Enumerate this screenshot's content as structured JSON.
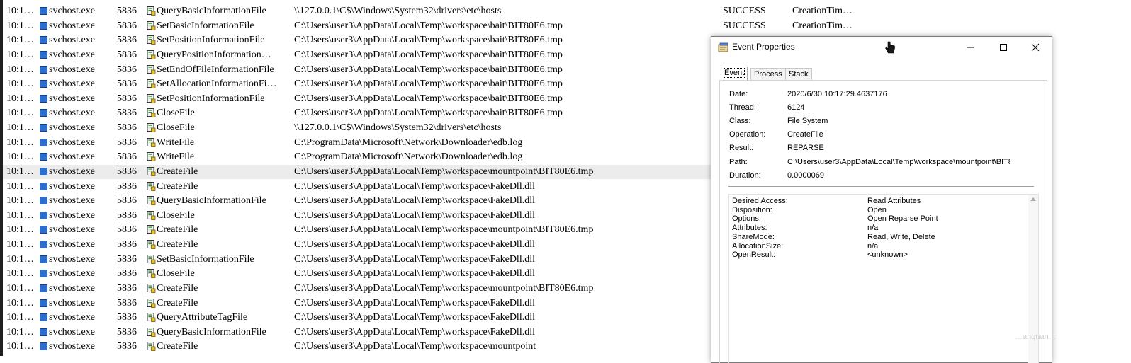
{
  "rows": [
    {
      "time": "10:1…",
      "process": "svchost.exe",
      "pid": "5836",
      "operation": "QueryBasicInformationFile",
      "path": "\\\\127.0.0.1\\C$\\Windows\\System32\\drivers\\etc\\hosts",
      "result": "SUCCESS",
      "detail": "CreationTim…"
    },
    {
      "time": "10:1…",
      "process": "svchost.exe",
      "pid": "5836",
      "operation": "SetBasicInformationFile",
      "path": "C:\\Users\\user3\\AppData\\Local\\Temp\\workspace\\bait\\BIT80E6.tmp",
      "result": "SUCCESS",
      "detail": "CreationTim…"
    },
    {
      "time": "10:1…",
      "process": "svchost.exe",
      "pid": "5836",
      "operation": "SetPositionInformationFile",
      "path": "C:\\Users\\user3\\AppData\\Local\\Temp\\workspace\\bait\\BIT80E6.tmp",
      "result": "",
      "detail": ""
    },
    {
      "time": "10:1…",
      "process": "svchost.exe",
      "pid": "5836",
      "operation": "QueryPositionInformation…",
      "path": "C:\\Users\\user3\\AppData\\Local\\Temp\\workspace\\bait\\BIT80E6.tmp",
      "result": "",
      "detail": ""
    },
    {
      "time": "10:1…",
      "process": "svchost.exe",
      "pid": "5836",
      "operation": "SetEndOfFileInformationFile",
      "path": "C:\\Users\\user3\\AppData\\Local\\Temp\\workspace\\bait\\BIT80E6.tmp",
      "result": "",
      "detail": ""
    },
    {
      "time": "10:1…",
      "process": "svchost.exe",
      "pid": "5836",
      "operation": "SetAllocationInformationFi…",
      "path": "C:\\Users\\user3\\AppData\\Local\\Temp\\workspace\\bait\\BIT80E6.tmp",
      "result": "",
      "detail": ""
    },
    {
      "time": "10:1…",
      "process": "svchost.exe",
      "pid": "5836",
      "operation": "SetPositionInformationFile",
      "path": "C:\\Users\\user3\\AppData\\Local\\Temp\\workspace\\bait\\BIT80E6.tmp",
      "result": "",
      "detail": ""
    },
    {
      "time": "10:1…",
      "process": "svchost.exe",
      "pid": "5836",
      "operation": "CloseFile",
      "path": "C:\\Users\\user3\\AppData\\Local\\Temp\\workspace\\bait\\BIT80E6.tmp",
      "result": "",
      "detail": ""
    },
    {
      "time": "10:1…",
      "process": "svchost.exe",
      "pid": "5836",
      "operation": "CloseFile",
      "path": "\\\\127.0.0.1\\C$\\Windows\\System32\\drivers\\etc\\hosts",
      "result": "",
      "detail": ""
    },
    {
      "time": "10:1…",
      "process": "svchost.exe",
      "pid": "5836",
      "operation": "WriteFile",
      "path": "C:\\ProgramData\\Microsoft\\Network\\Downloader\\edb.log",
      "result": "",
      "detail": ""
    },
    {
      "time": "10:1…",
      "process": "svchost.exe",
      "pid": "5836",
      "operation": "WriteFile",
      "path": "C:\\ProgramData\\Microsoft\\Network\\Downloader\\edb.log",
      "result": "",
      "detail": ""
    },
    {
      "time": "10:1…",
      "process": "svchost.exe",
      "pid": "5836",
      "operation": "CreateFile",
      "path": "C:\\Users\\user3\\AppData\\Local\\Temp\\workspace\\mountpoint\\BIT80E6.tmp",
      "result": "",
      "detail": "",
      "selected": true
    },
    {
      "time": "10:1…",
      "process": "svchost.exe",
      "pid": "5836",
      "operation": "CreateFile",
      "path": "C:\\Users\\user3\\AppData\\Local\\Temp\\workspace\\FakeDll.dll",
      "result": "",
      "detail": ""
    },
    {
      "time": "10:1…",
      "process": "svchost.exe",
      "pid": "5836",
      "operation": "QueryBasicInformationFile",
      "path": "C:\\Users\\user3\\AppData\\Local\\Temp\\workspace\\FakeDll.dll",
      "result": "",
      "detail": ""
    },
    {
      "time": "10:1…",
      "process": "svchost.exe",
      "pid": "5836",
      "operation": "CloseFile",
      "path": "C:\\Users\\user3\\AppData\\Local\\Temp\\workspace\\FakeDll.dll",
      "result": "",
      "detail": ""
    },
    {
      "time": "10:1…",
      "process": "svchost.exe",
      "pid": "5836",
      "operation": "CreateFile",
      "path": "C:\\Users\\user3\\AppData\\Local\\Temp\\workspace\\mountpoint\\BIT80E6.tmp",
      "result": "",
      "detail": ""
    },
    {
      "time": "10:1…",
      "process": "svchost.exe",
      "pid": "5836",
      "operation": "CreateFile",
      "path": "C:\\Users\\user3\\AppData\\Local\\Temp\\workspace\\FakeDll.dll",
      "result": "",
      "detail": ""
    },
    {
      "time": "10:1…",
      "process": "svchost.exe",
      "pid": "5836",
      "operation": "SetBasicInformationFile",
      "path": "C:\\Users\\user3\\AppData\\Local\\Temp\\workspace\\FakeDll.dll",
      "result": "",
      "detail": ""
    },
    {
      "time": "10:1…",
      "process": "svchost.exe",
      "pid": "5836",
      "operation": "CloseFile",
      "path": "C:\\Users\\user3\\AppData\\Local\\Temp\\workspace\\FakeDll.dll",
      "result": "",
      "detail": ""
    },
    {
      "time": "10:1…",
      "process": "svchost.exe",
      "pid": "5836",
      "operation": "CreateFile",
      "path": "C:\\Users\\user3\\AppData\\Local\\Temp\\workspace\\mountpoint\\BIT80E6.tmp",
      "result": "",
      "detail": ""
    },
    {
      "time": "10:1…",
      "process": "svchost.exe",
      "pid": "5836",
      "operation": "CreateFile",
      "path": "C:\\Users\\user3\\AppData\\Local\\Temp\\workspace\\FakeDll.dll",
      "result": "",
      "detail": ""
    },
    {
      "time": "10:1…",
      "process": "svchost.exe",
      "pid": "5836",
      "operation": "QueryAttributeTagFile",
      "path": "C:\\Users\\user3\\AppData\\Local\\Temp\\workspace\\FakeDll.dll",
      "result": "",
      "detail": ""
    },
    {
      "time": "10:1…",
      "process": "svchost.exe",
      "pid": "5836",
      "operation": "QueryBasicInformationFile",
      "path": "C:\\Users\\user3\\AppData\\Local\\Temp\\workspace\\FakeDll.dll",
      "result": "",
      "detail": ""
    },
    {
      "time": "10:1…",
      "process": "svchost.exe",
      "pid": "5836",
      "operation": "CreateFile",
      "path": "C:\\Users\\user3\\AppData\\Local\\Temp\\workspace\\mountpoint",
      "result": "",
      "detail": ""
    }
  ],
  "dialog": {
    "title": "Event Properties",
    "tabs": [
      "Event",
      "Process",
      "Stack"
    ],
    "active_tab": "Event",
    "fields": [
      {
        "label": "Date:",
        "value": "2020/6/30 10:17:29.4637176"
      },
      {
        "label": "Thread:",
        "value": "6124"
      },
      {
        "label": "Class:",
        "value": "File System"
      },
      {
        "label": "Operation:",
        "value": "CreateFile"
      },
      {
        "label": "Result:",
        "value": "REPARSE"
      },
      {
        "label": "Path:",
        "value": "C:\\Users\\user3\\AppData\\Local\\Temp\\workspace\\mountpoint\\BIT8"
      },
      {
        "label": "Duration:",
        "value": "0.0000069"
      }
    ],
    "details": [
      {
        "key": "Desired Access:",
        "value": "Read Attributes"
      },
      {
        "key": "Disposition:",
        "value": "Open"
      },
      {
        "key": "Options:",
        "value": "Open Reparse Point"
      },
      {
        "key": "Attributes:",
        "value": "n/a"
      },
      {
        "key": "ShareMode:",
        "value": "Read, Write, Delete"
      },
      {
        "key": "AllocationSize:",
        "value": "n/a"
      },
      {
        "key": "OpenResult:",
        "value": "<unknown>"
      }
    ]
  },
  "watermark": "…anquan…",
  "colors": {
    "selected_row": "#ececec",
    "process_icon": "#2b6fd0",
    "op_icon_doc": "#f2f2f2",
    "op_icon_accent": "#2e8b2e"
  }
}
